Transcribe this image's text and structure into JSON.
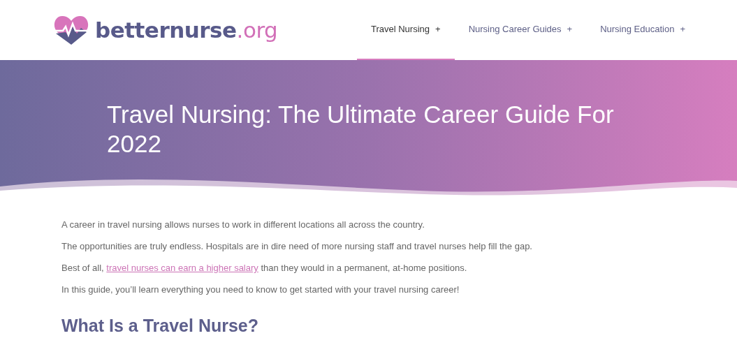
{
  "logo": {
    "name": "betternurse",
    "suffix": ".org"
  },
  "nav": [
    {
      "label": "Travel Nursing",
      "toggle": "+",
      "selected": true
    },
    {
      "label": "Nursing Career Guides",
      "toggle": "+",
      "selected": false
    },
    {
      "label": "Nursing Education",
      "toggle": "+",
      "selected": false
    }
  ],
  "hero": {
    "title": "Travel Nursing: The Ultimate Career Guide For 2022"
  },
  "paragraphs": [
    {
      "kind": "text",
      "text": "A career in travel nursing allows nurses to work in different locations all across the country."
    },
    {
      "kind": "text",
      "text": "The opportunities are truly endless. Hospitals are in dire need of more nursing staff and travel nurses help fill the gap."
    },
    {
      "kind": "link",
      "before": "Best of all, ",
      "link": "travel nurses can earn a higher salary",
      "after": " than they would in a permanent, at-home positions."
    },
    {
      "kind": "text",
      "text": "In this guide, you’ll learn everything you need to know to get started with your travel nursing career!"
    }
  ],
  "section_heading": "What Is a Travel Nurse?"
}
